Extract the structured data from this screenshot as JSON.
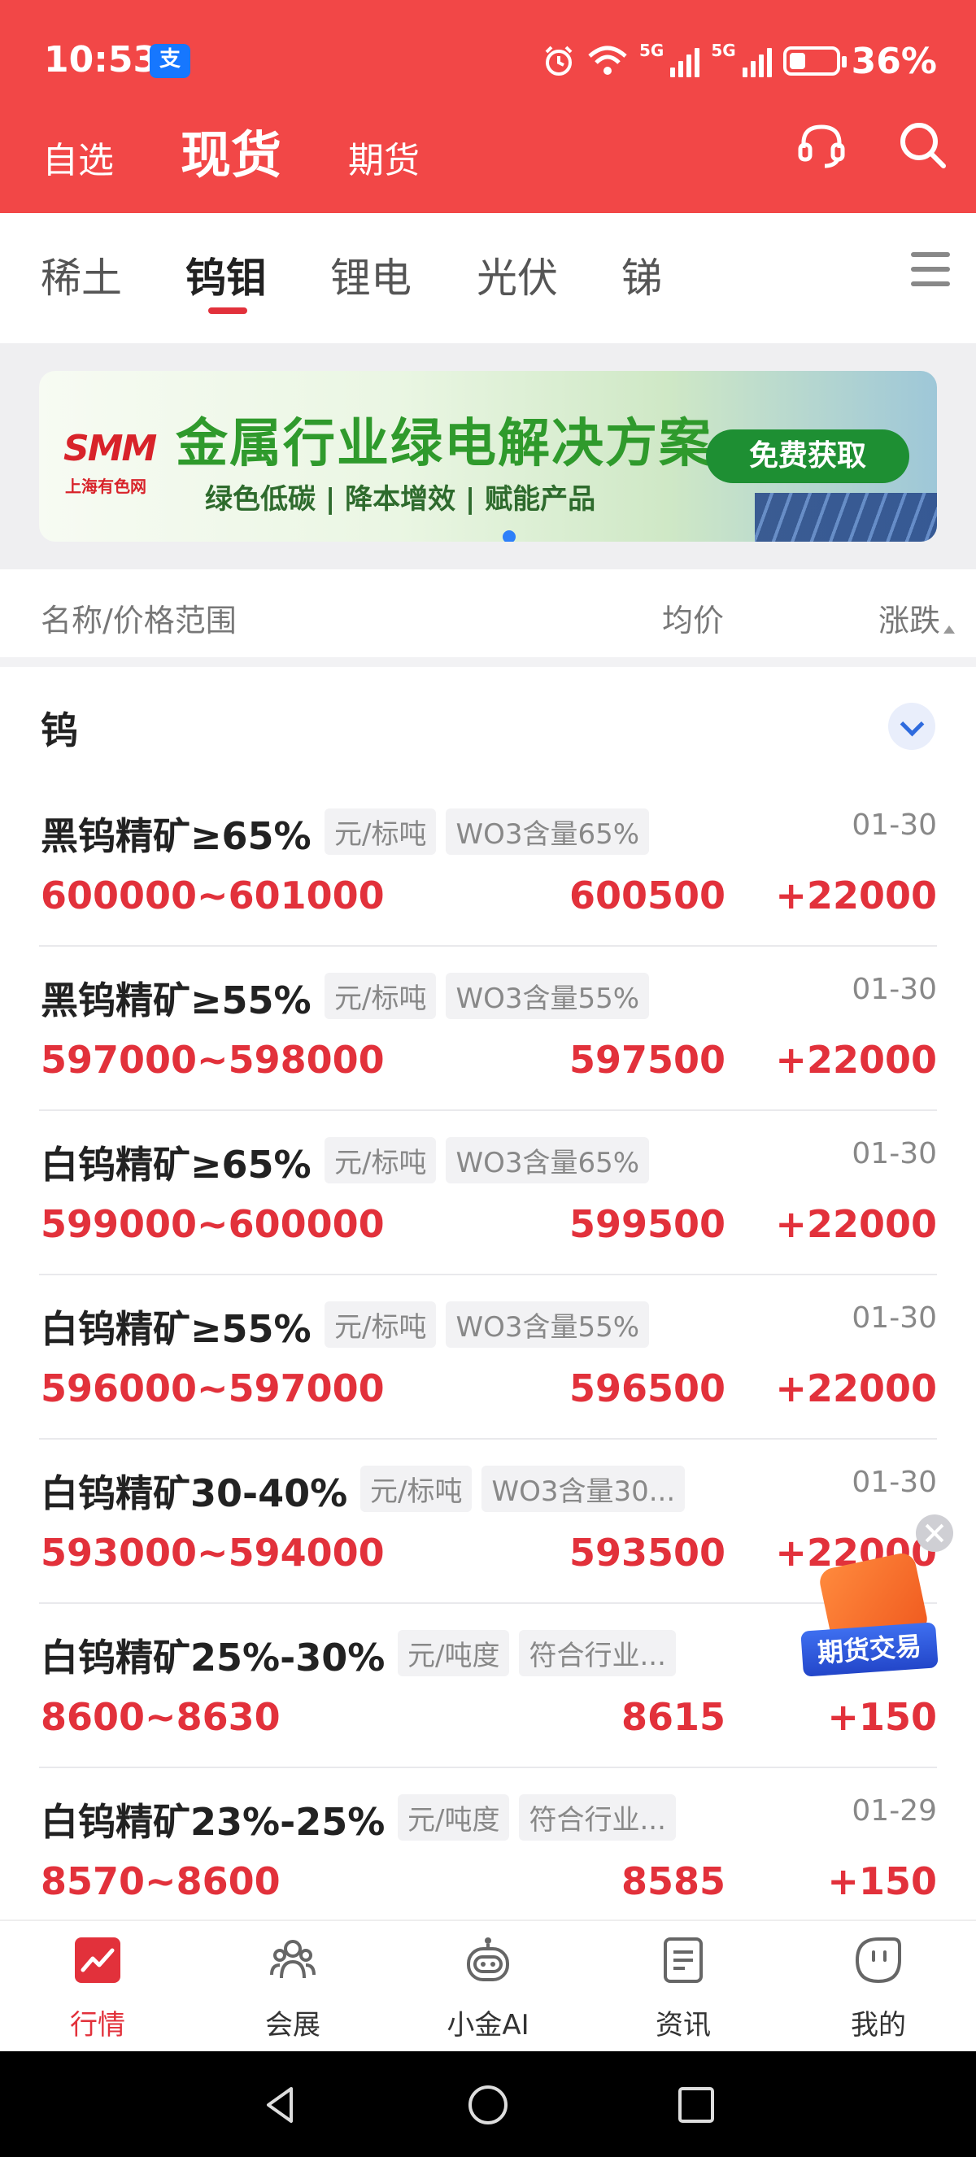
{
  "status_bar": {
    "time": "10:53",
    "app_badge": "支",
    "network_1": "5G",
    "network_2": "5G",
    "battery_percent": "36%",
    "battery_level": 0.36
  },
  "header": {
    "tabs": [
      "自选",
      "现货",
      "期货"
    ],
    "active_tab": "现货",
    "icons": [
      "headset-icon",
      "search-icon"
    ]
  },
  "categories": {
    "items": [
      "稀土",
      "钨钼",
      "锂电",
      "光伏",
      "锑"
    ],
    "active": "钨钼"
  },
  "banner": {
    "logo": "SMM",
    "logo_sub": "上海有色网",
    "title": "金属行业绿电解决方案",
    "subtitle": "绿色低碳 | 降本增效 | 赋能产品",
    "button": "免费获取"
  },
  "list_header": {
    "name": "名称/价格范围",
    "avg": "均价",
    "change": "涨跌"
  },
  "group": {
    "title": "钨",
    "rows": [
      {
        "name": "黑钨精矿≥65%",
        "unit": "元/标吨",
        "spec": "WO3含量65%",
        "date": "01-30",
        "range": "600000~601000",
        "avg": "600500",
        "change": "+22000"
      },
      {
        "name": "黑钨精矿≥55%",
        "unit": "元/标吨",
        "spec": "WO3含量55%",
        "date": "01-30",
        "range": "597000~598000",
        "avg": "597500",
        "change": "+22000"
      },
      {
        "name": "白钨精矿≥65%",
        "unit": "元/标吨",
        "spec": "WO3含量65%",
        "date": "01-30",
        "range": "599000~600000",
        "avg": "599500",
        "change": "+22000"
      },
      {
        "name": "白钨精矿≥55%",
        "unit": "元/标吨",
        "spec": "WO3含量55%",
        "date": "01-30",
        "range": "596000~597000",
        "avg": "596500",
        "change": "+22000"
      },
      {
        "name": "白钨精矿30-40%",
        "unit": "元/标吨",
        "spec": "WO3含量30...",
        "date": "01-30",
        "range": "593000~594000",
        "avg": "593500",
        "change": "+22000"
      },
      {
        "name": "白钨精矿25%-30%",
        "unit": "元/吨度",
        "spec": "符合行业...",
        "date": "",
        "range": "8600~8630",
        "avg": "8615",
        "change": "+150"
      },
      {
        "name": "白钨精矿23%-25%",
        "unit": "元/吨度",
        "spec": "符合行业...",
        "date": "01-29",
        "range": "8570~8600",
        "avg": "8585",
        "change": "+150"
      }
    ]
  },
  "floating": {
    "label": "期货交易"
  },
  "bottom_nav": {
    "items": [
      "行情",
      "会展",
      "小金AI",
      "资讯",
      "我的"
    ],
    "active": "行情"
  },
  "colors": {
    "header_red": "#f24747",
    "price_red": "#e2313b",
    "banner_green": "#2f9a2c"
  }
}
